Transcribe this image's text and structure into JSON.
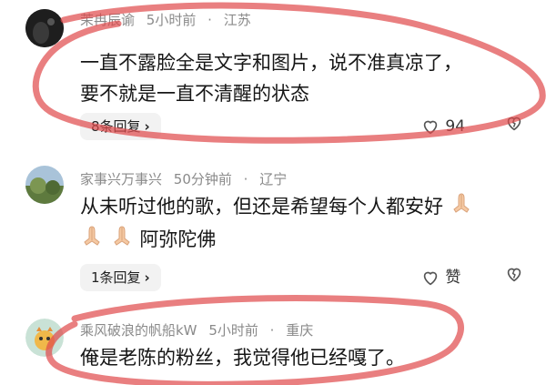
{
  "comments": [
    {
      "username": "茉冉辰谕",
      "time": "5小时前",
      "location": "江苏",
      "lines": [
        "一直不露脸全是文字和图片，说不准真凉了，",
        "要不就是一直不清醒的状态"
      ],
      "reply_label": "8条回复",
      "likes": "94",
      "avatar_color": "#1c1c1c"
    },
    {
      "username": "家事兴万事兴",
      "time": "50分钟前",
      "location": "辽宁",
      "lines": [
        "从未听过他的歌，但还是希望每个人都安好",
        "阿弥陀佛"
      ],
      "reply_label": "1条回复",
      "likes": "赞",
      "avatar_color": "#6f8a52"
    },
    {
      "username": "乘风破浪的帆船kW",
      "time": "5小时前",
      "location": "重庆",
      "lines": [
        "俺是老陈的粉丝，我觉得他已经嘎了。"
      ],
      "avatar_color": "#c7e0d4"
    }
  ],
  "icons": {
    "like": "heart-outline-icon",
    "dislike": "broken-heart-icon",
    "reply_chevron": "chevron-right-icon",
    "pray": "folded-hands-icon"
  },
  "colors": {
    "annotation": "#e0484a",
    "meta_text": "#8a8a8a"
  }
}
